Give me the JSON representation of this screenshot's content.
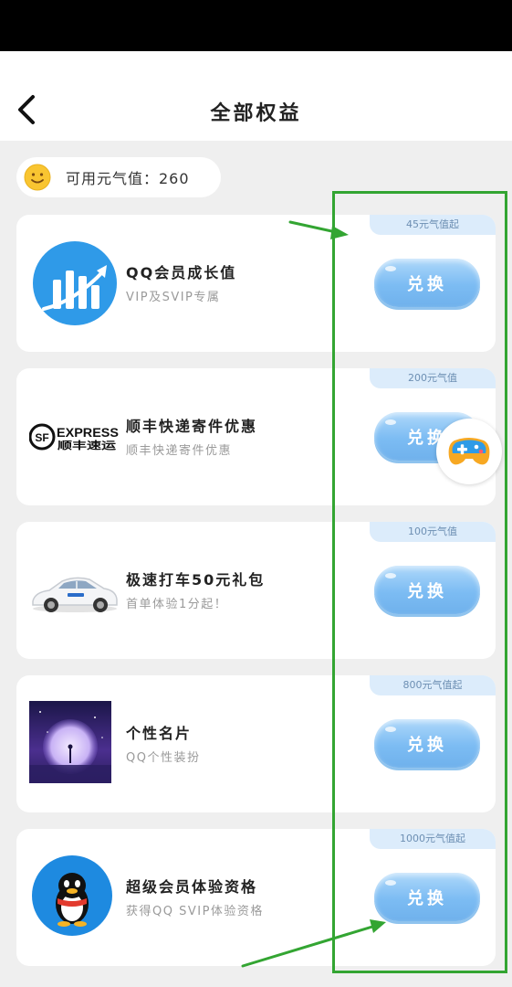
{
  "header": {
    "title": "全部权益",
    "back_icon": "chevron-left-icon"
  },
  "points": {
    "label": "可用元气值：260",
    "icon": "smiley-face-icon"
  },
  "rewards": [
    {
      "title": "QQ会员成长值",
      "subtitle": "VIP及SVIP专属",
      "tag": "45元气值起",
      "button": "兑换",
      "image": "growth-chart-icon"
    },
    {
      "title": "顺丰快递寄件优惠",
      "subtitle": "顺丰快递寄件优惠",
      "tag": "200元气值",
      "button": "兑换",
      "image": "sf-express-logo",
      "logo_text": {
        "sf": "SF",
        "express": "EXPRESS",
        "cn": "顺丰速运"
      }
    },
    {
      "title": "极速打车50元礼包",
      "subtitle": "首单体验1分起！",
      "tag": "100元气值",
      "button": "兑换",
      "image": "white-car-image"
    },
    {
      "title": "个性名片",
      "subtitle": "QQ个性装扮",
      "tag": "800元气值起",
      "button": "兑换",
      "image": "purple-moon-scene-image"
    },
    {
      "title": "超级会员体验资格",
      "subtitle": "获得QQ SVIP体验资格",
      "tag": "1000元气值起",
      "button": "兑换",
      "image": "qq-penguin-icon"
    }
  ],
  "floating": {
    "icon": "gamepad-icon"
  },
  "colors": {
    "accent_blue": "#7cbcf3",
    "tag_bg": "#dcecfb",
    "annotation_green": "#33a532",
    "background": "#efefef"
  }
}
